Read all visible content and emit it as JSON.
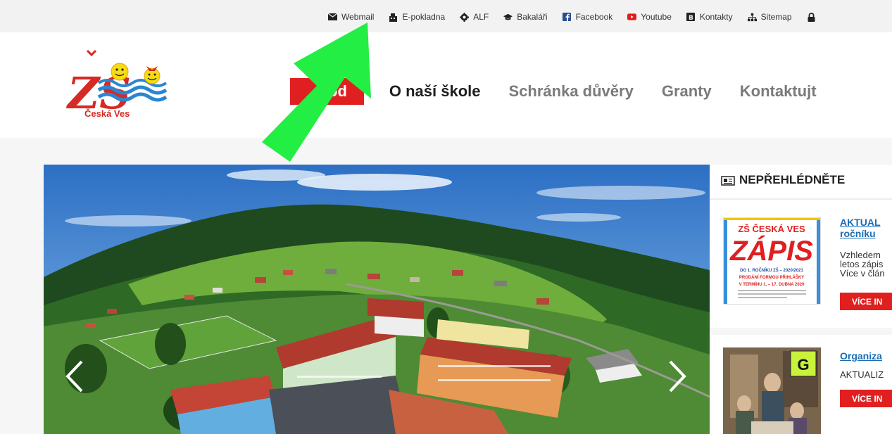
{
  "topbar": {
    "links": [
      {
        "label": "Webmail",
        "icon": "envelope-icon"
      },
      {
        "label": "E-pokladna",
        "icon": "cash-register-icon"
      },
      {
        "label": "ALF",
        "icon": "gear-icon"
      },
      {
        "label": "Bakaláři",
        "icon": "graduation-cap-icon"
      },
      {
        "label": "Facebook",
        "icon": "facebook-icon"
      },
      {
        "label": "Youtube",
        "icon": "youtube-icon"
      },
      {
        "label": "Kontakty",
        "icon": "contact-card-icon"
      },
      {
        "label": "Sitemap",
        "icon": "sitemap-icon"
      }
    ]
  },
  "header": {
    "logo_letters": "ZŠ",
    "logo_name": "Česká Ves",
    "nav": [
      {
        "label": "od"
      },
      {
        "label": "O naší škole"
      },
      {
        "label": "Schránka důvěry"
      },
      {
        "label": "Granty"
      },
      {
        "label": "Kontaktujt"
      }
    ]
  },
  "sidebar": {
    "heading": "NEPŘEHLÉDNĚTE",
    "articles": [
      {
        "title_line1": "AKTUAL",
        "title_line2": "ročníku",
        "text_line1": "Vzhledem",
        "text_line2": "letos zápis",
        "text_line3": "Více v člán",
        "button": "VÍCE IN",
        "thumb": {
          "line1": "ZŠ ČESKÁ VES",
          "line2": "ZÁPIS",
          "line3": "DO 1. ROČNÍKU ZŠ – 2020/2021",
          "line4": "PRODÁNÍ FORMOU PŘIHLÁŠKY",
          "line5": "V TERMÍNU 1. – 17. DUBNA 2020"
        }
      },
      {
        "title_line1": "Organiza",
        "text_line1": "AKTUALIZ",
        "button": "VÍCE IN",
        "thumb": {
          "badge": "G"
        }
      }
    ]
  },
  "colors": {
    "accent_red": "#e02020",
    "link_blue": "#1a6db3",
    "highlight_green": "#22ee44"
  }
}
